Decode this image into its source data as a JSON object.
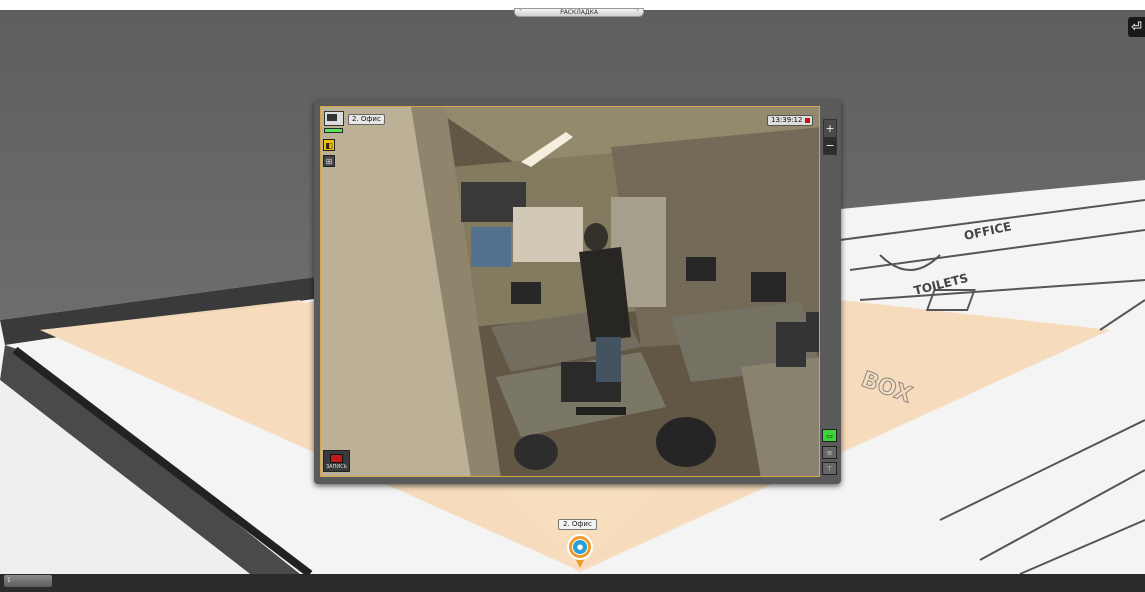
{
  "top_dropdown": {
    "label": "РАСКЛАДКА"
  },
  "camera_window": {
    "title": "2. Офис",
    "timestamp": "13:39:12",
    "record_label": "ЗАПИСЬ"
  },
  "map": {
    "camera_label": "2. Офис",
    "floor_texts": [
      "OFFICE",
      "TOILETS",
      "BOX"
    ]
  },
  "bottom_bar": {
    "tab_label": "1"
  },
  "colors": {
    "highlight_frame": "#d2a64a",
    "coverage_area": "#f6dcbc",
    "active_green": "#3bd43b",
    "pin_orange": "#f09a2a",
    "pin_blue": "#2a9fd6",
    "record_red": "#c41a1a"
  },
  "icons": {
    "exit": "exit-icon",
    "camera": "camera-icon",
    "archive": "archive-icon",
    "layout": "layout-icon",
    "monitor": "monitor-icon",
    "record": "record-icon",
    "pin": "camera-pin-icon"
  }
}
